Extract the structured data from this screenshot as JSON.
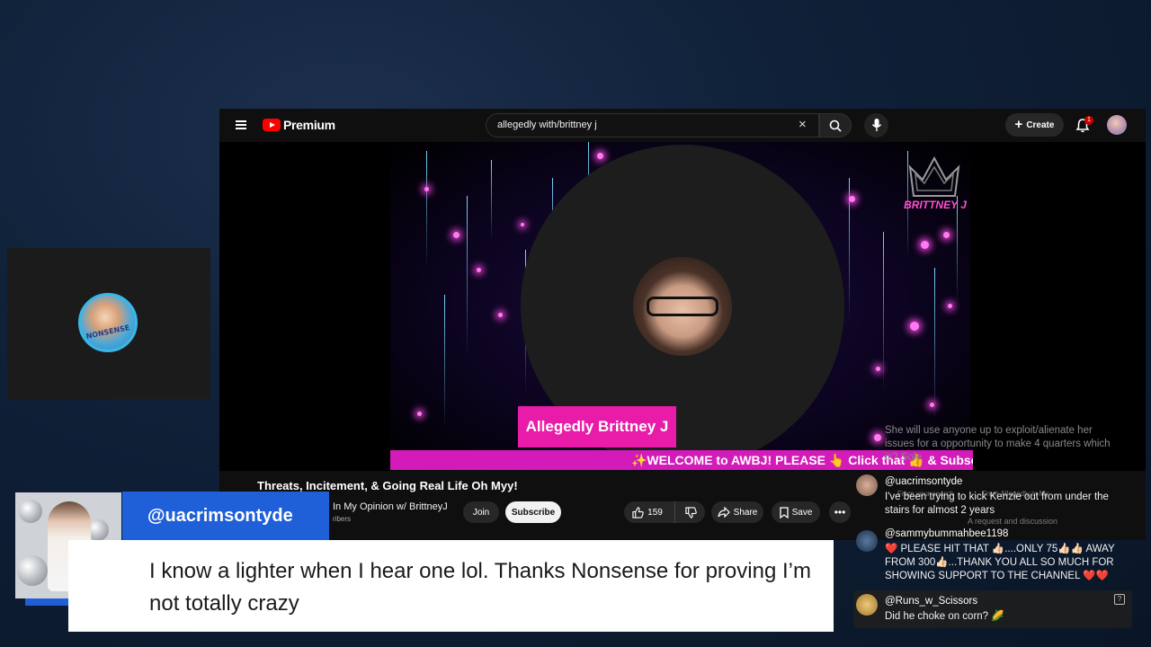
{
  "youtube": {
    "logo_text": "Premium",
    "search": {
      "value": "allegedly with/brittney j"
    },
    "create_label": "Create",
    "notification_count": "1"
  },
  "video": {
    "name_plate": "Allegedly Brittney J",
    "ticker": "✨WELCOME to AWBJ! PLEASE 👆 Click that 👍 & Subscr",
    "brand": "BRITTNEY J",
    "title": "Threats, Incitement, & Going Real Life Oh Myy!",
    "channel": "In My Opinion w/ BrittneyJ",
    "subscribers_fragment": "ribers",
    "join_label": "Join",
    "subscribe_label": "Subscribe",
    "likes": "159",
    "share_label": "Share",
    "save_label": "Save"
  },
  "chat": {
    "faded_message": "She will use anyone up to exploit/alienate her issues for a opportunity to make 4 quarters which is? Sole",
    "messages": [
      {
        "user": "@uacrimsontyde",
        "text": "I've been trying to kick Kenzie out from under the stairs for almost 2 years"
      },
      {
        "user": "@sammybummahbee1198",
        "text": "❤️ PLEASE HIT THAT 👍🏻....ONLY 75👍🏻👍🏻 AWAY FROM 300👍🏻...THANK YOU ALL SO MUCH FOR SHOWING SUPPORT TO THE CHANNEL ❤️❤️"
      },
      {
        "user": "@Runs_w_Scissors",
        "text": "Did he choke on corn? 🌽"
      }
    ],
    "ghost_1": "A request and discussion",
    "ghost_2": "From your search",
    "ghost_3": "From Allegedly in My"
  },
  "lower_third": {
    "username": "@uacrimsontyde",
    "comment": "I know a lighter when I hear one lol. Thanks Nonsense for proving I’m not totally crazy"
  },
  "cam": {
    "badge_text": "NONSENSE"
  },
  "colors": {
    "accent_pink": "#e81ca8",
    "lower_third_blue": "#1f5fd8",
    "youtube_red": "#ff0000"
  }
}
